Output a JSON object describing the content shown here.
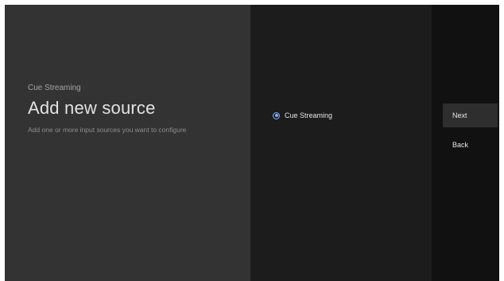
{
  "guidance": {
    "breadcrumb": "Cue Streaming",
    "title": "Add new source",
    "description": "Add one or more input sources you want to configure"
  },
  "sources": {
    "items": [
      {
        "label": "Cue Streaming",
        "selected": true
      }
    ]
  },
  "actions": {
    "next_label": "Next",
    "back_label": "Back"
  },
  "colors": {
    "accent": "#7fb3ff",
    "info_pane": "#333333",
    "list_pane": "#1c1c1c",
    "actions_pane": "#111111"
  }
}
